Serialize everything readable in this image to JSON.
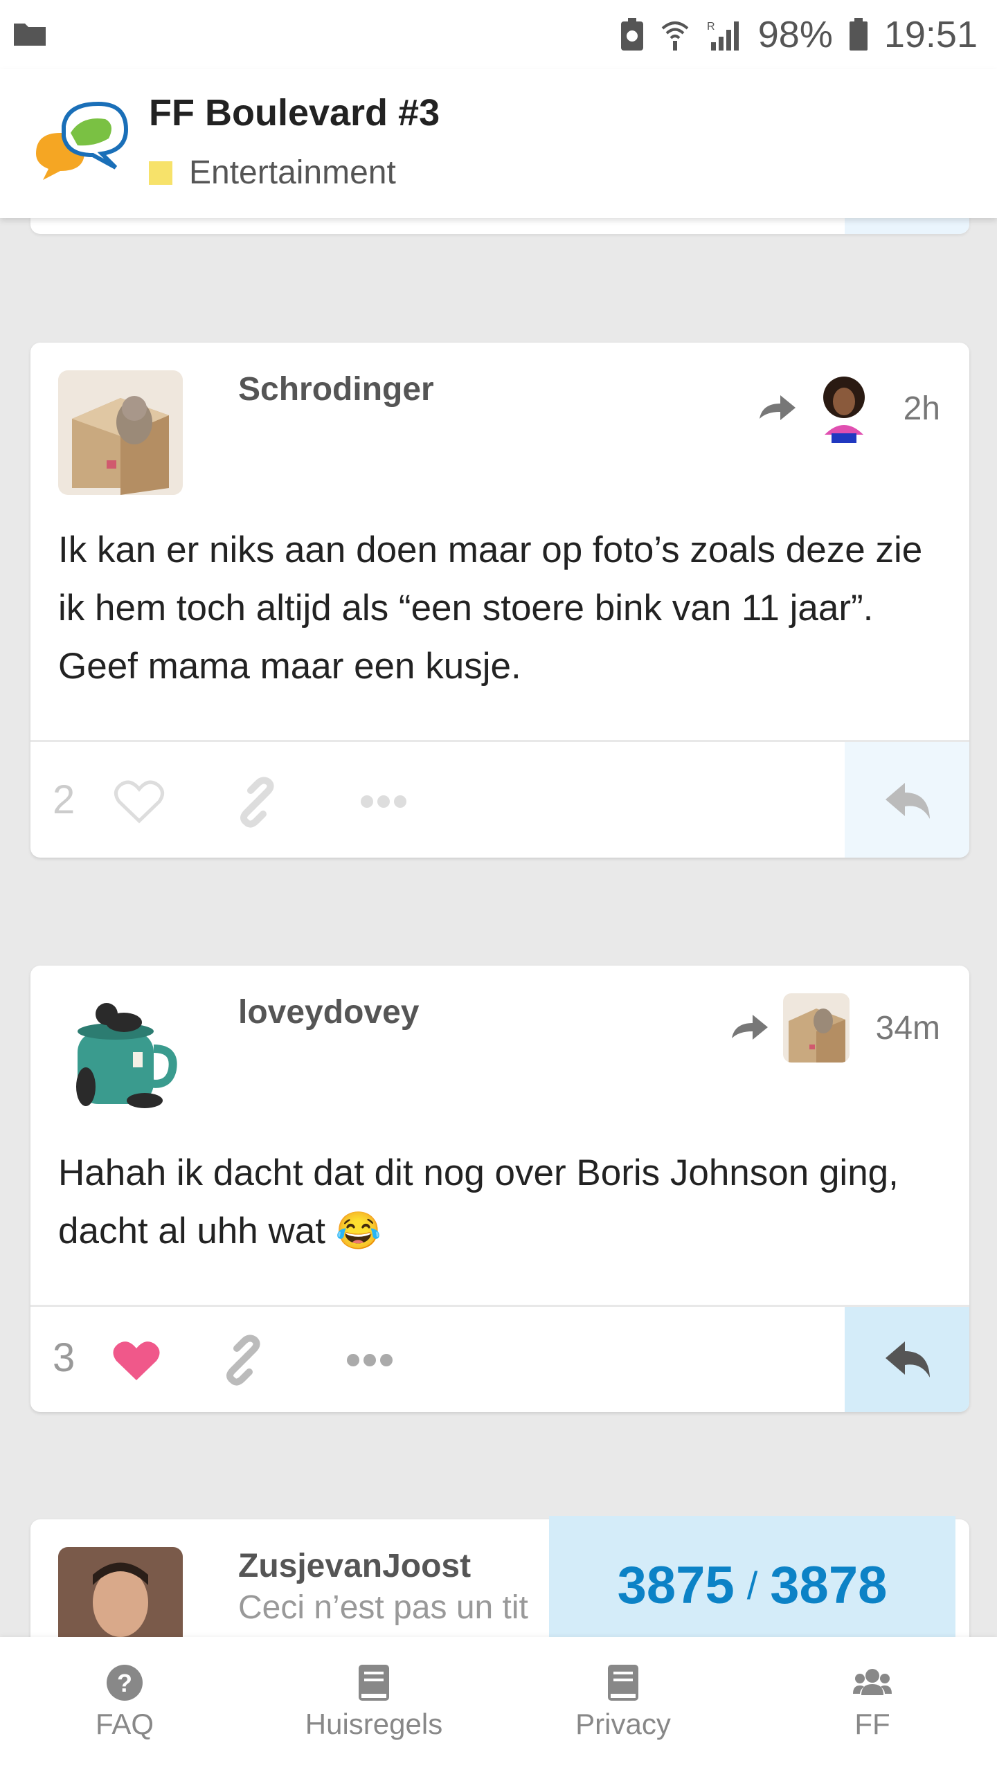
{
  "status_bar": {
    "battery": "98%",
    "time": "19:51",
    "signal_label": "R"
  },
  "header": {
    "title": "FF Boulevard #3",
    "category": "Entertainment",
    "category_color": "#f7e26a"
  },
  "posts": [
    {
      "username": "Schrodinger",
      "time": "2h",
      "text": "Ik kan er niks aan doen maar op foto’s zoals deze zie ik hem toch altijd als “een stoere bink van 11 jaar”. Geef mama maar een kusje.",
      "likes": "2",
      "liked": false
    },
    {
      "username": "loveydovey",
      "time": "34m",
      "text": "Hahah ik dacht dat dit nog over Boris Johnson ging, dacht al uhh wat",
      "emoji": "😂",
      "likes": "3",
      "liked": true
    },
    {
      "username": "ZusjevanJoost",
      "text": "Ceci n’est pas un tit"
    }
  ],
  "progress": {
    "current": "3875",
    "separator": "/",
    "total": "3878"
  },
  "footer": {
    "items": [
      {
        "label": "FAQ",
        "icon": "question-icon"
      },
      {
        "label": "Huisregels",
        "icon": "book-icon"
      },
      {
        "label": "Privacy",
        "icon": "book-icon"
      },
      {
        "label": "FF",
        "icon": "users-icon"
      }
    ]
  },
  "colors": {
    "accent": "#0c82c6",
    "heart": "#f0588a",
    "reply_bg": "#d4ecf9"
  }
}
